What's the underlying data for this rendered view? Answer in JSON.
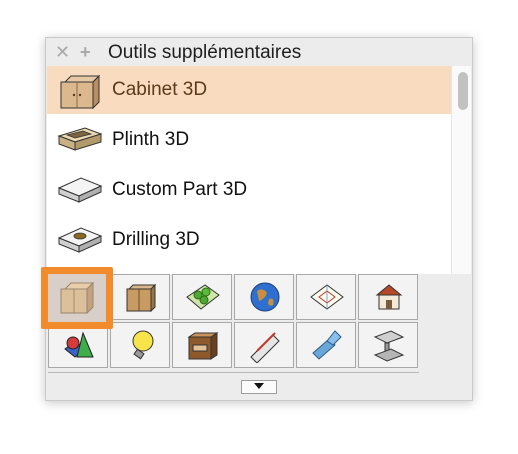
{
  "window": {
    "title": "Outils supplémentaires"
  },
  "titlebar": {
    "close_icon": "close-icon",
    "add_icon": "plus-icon"
  },
  "list": {
    "items": [
      {
        "label": "Cabinet 3D",
        "icon": "cabinet-3d-icon",
        "selected": true
      },
      {
        "label": "Plinth 3D",
        "icon": "plinth-3d-icon",
        "selected": false
      },
      {
        "label": "Custom Part 3D",
        "icon": "custom-part-3d-icon",
        "selected": false
      },
      {
        "label": "Drilling 3D",
        "icon": "drilling-3d-icon",
        "selected": false
      }
    ]
  },
  "tool_grid": {
    "active_index": 0,
    "rows": [
      [
        "cabinet-3d-icon",
        "cabinet-icon",
        "landscape-plants-icon",
        "globe-icon",
        "site-plan-icon",
        "house-icon"
      ],
      [
        "primitives-3d-icon",
        "light-bulb-icon",
        "drawer-cabinet-icon",
        "ruler-pencil-icon",
        "pipe-tee-icon",
        "steel-beam-icon"
      ]
    ]
  },
  "footer": {
    "dropdown_icon": "triangle-down-icon"
  },
  "colors": {
    "selected_row": "#f9dcbf",
    "highlight": "#f28b2b",
    "active_tool": "#f6a44d"
  }
}
